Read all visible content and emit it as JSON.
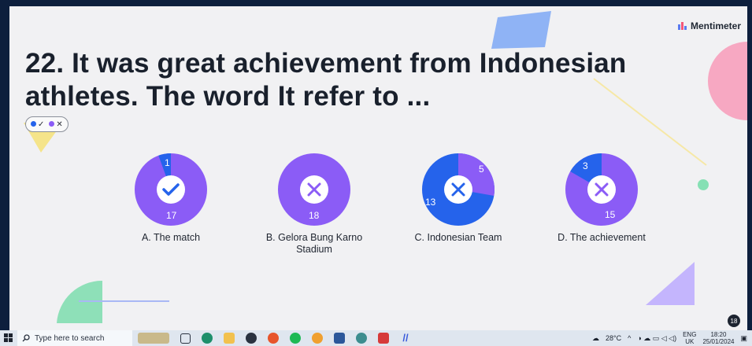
{
  "brand": {
    "name": "Mentimeter"
  },
  "question": {
    "title": "22. It was great achievement from Indonesian athletes. The word It refer to ..."
  },
  "legend": {
    "correct_symbol": "✓",
    "incorrect_symbol": "✕"
  },
  "colors": {
    "purple": "#8b5cf6",
    "blue": "#2563eb",
    "pink": "#f9a8c4",
    "green": "#86e0b4",
    "yellow": "#f7e27a",
    "slide_bg": "#f1f1f3"
  },
  "chart_data": {
    "type": "pie",
    "charts": [
      {
        "label": "A. The match",
        "values": {
          "correct": 17,
          "incorrect": 1
        },
        "is_correct": true
      },
      {
        "label": "B. Gelora Bung Karno Stadium",
        "values": {
          "correct": 0,
          "incorrect": 18
        },
        "is_correct": false
      },
      {
        "label": "C. Indonesian Team",
        "values": {
          "correct": 5,
          "incorrect": 13
        },
        "is_correct": false
      },
      {
        "label": "D. The achievement",
        "values": {
          "correct": 15,
          "incorrect": 3
        },
        "is_correct": false
      }
    ],
    "number_labels": [
      {
        "small": "1",
        "large": "17"
      },
      {
        "small": "",
        "large": "18"
      },
      {
        "small": "5",
        "large": "13"
      },
      {
        "small": "3",
        "large": "15"
      }
    ]
  },
  "taskbar": {
    "search_placeholder": "Type here to search",
    "weather": "28°C",
    "lang_top": "ENG",
    "lang_bottom": "UK",
    "time": "18:20",
    "date": "25/01/2024",
    "notification_count": "18"
  }
}
